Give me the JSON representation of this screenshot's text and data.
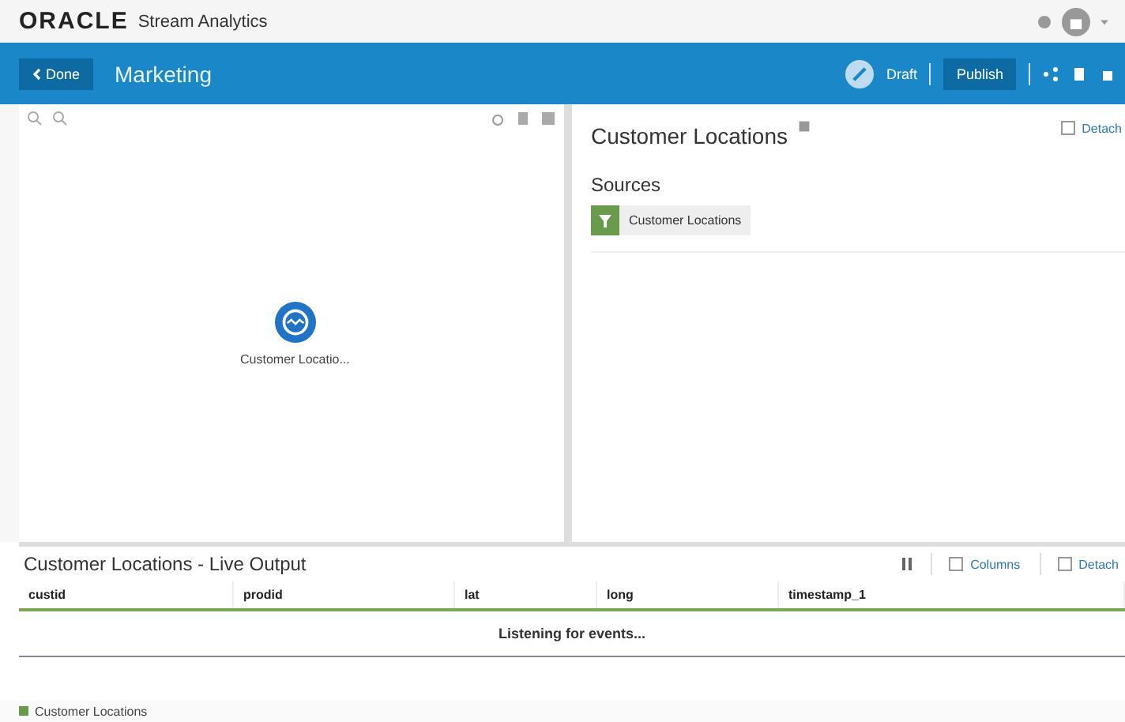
{
  "header": {
    "brand": "ORACLE",
    "product": "Stream Analytics"
  },
  "toolbar": {
    "back": "Done",
    "title": "Marketing",
    "status": "Draft",
    "publish": "Publish"
  },
  "canvas": {
    "nodes": [
      {
        "label": "Customer Locatio..."
      }
    ]
  },
  "detail": {
    "title": "Customer Locations",
    "detach": "Detach",
    "sources_heading": "Sources",
    "sources": [
      {
        "label": "Customer Locations"
      }
    ]
  },
  "output": {
    "title": "Customer Locations - Live Output",
    "columns_button": "Columns",
    "detach": "Detach",
    "columns": [
      "custid",
      "prodid",
      "lat",
      "long",
      "timestamp_1"
    ],
    "message": "Listening for events..."
  },
  "status_bar": {
    "label": "Customer Locations",
    "color": "#6a9a4b"
  }
}
